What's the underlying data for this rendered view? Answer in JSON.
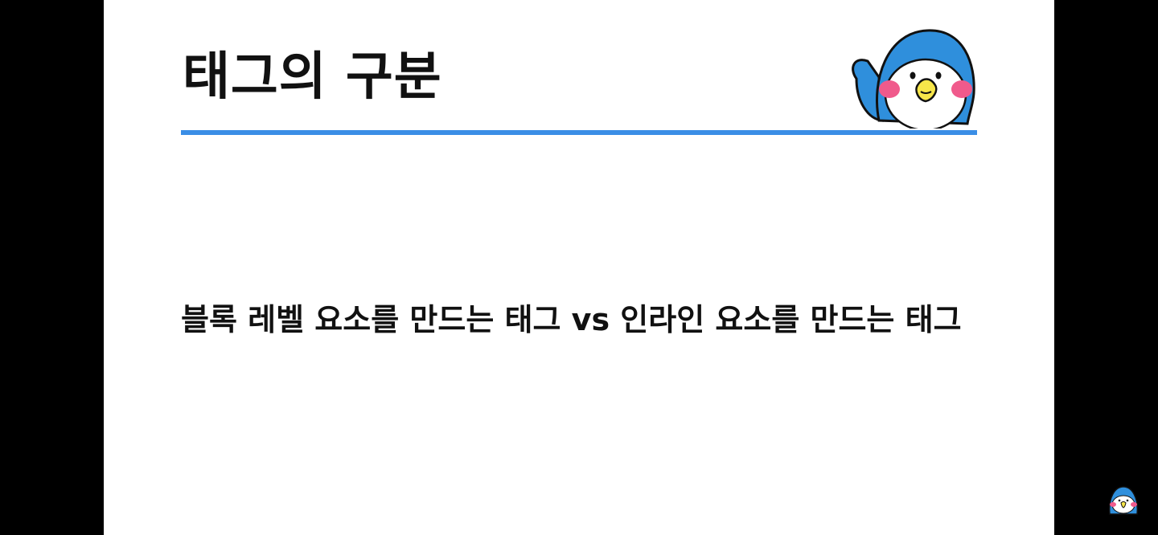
{
  "slide": {
    "title": "태그의 구분",
    "body": "블록 레벨 요소를 만드는 태그 vs 인라인 요소를 만드는 태그"
  },
  "mascot": {
    "icon": "penguin-mascot-icon"
  },
  "watermark": {
    "icon": "penguin-channel-icon"
  },
  "colors": {
    "accent": "#3a8ee6",
    "letterbox": "#000000",
    "slide_background": "#ffffff",
    "text": "#111111"
  }
}
